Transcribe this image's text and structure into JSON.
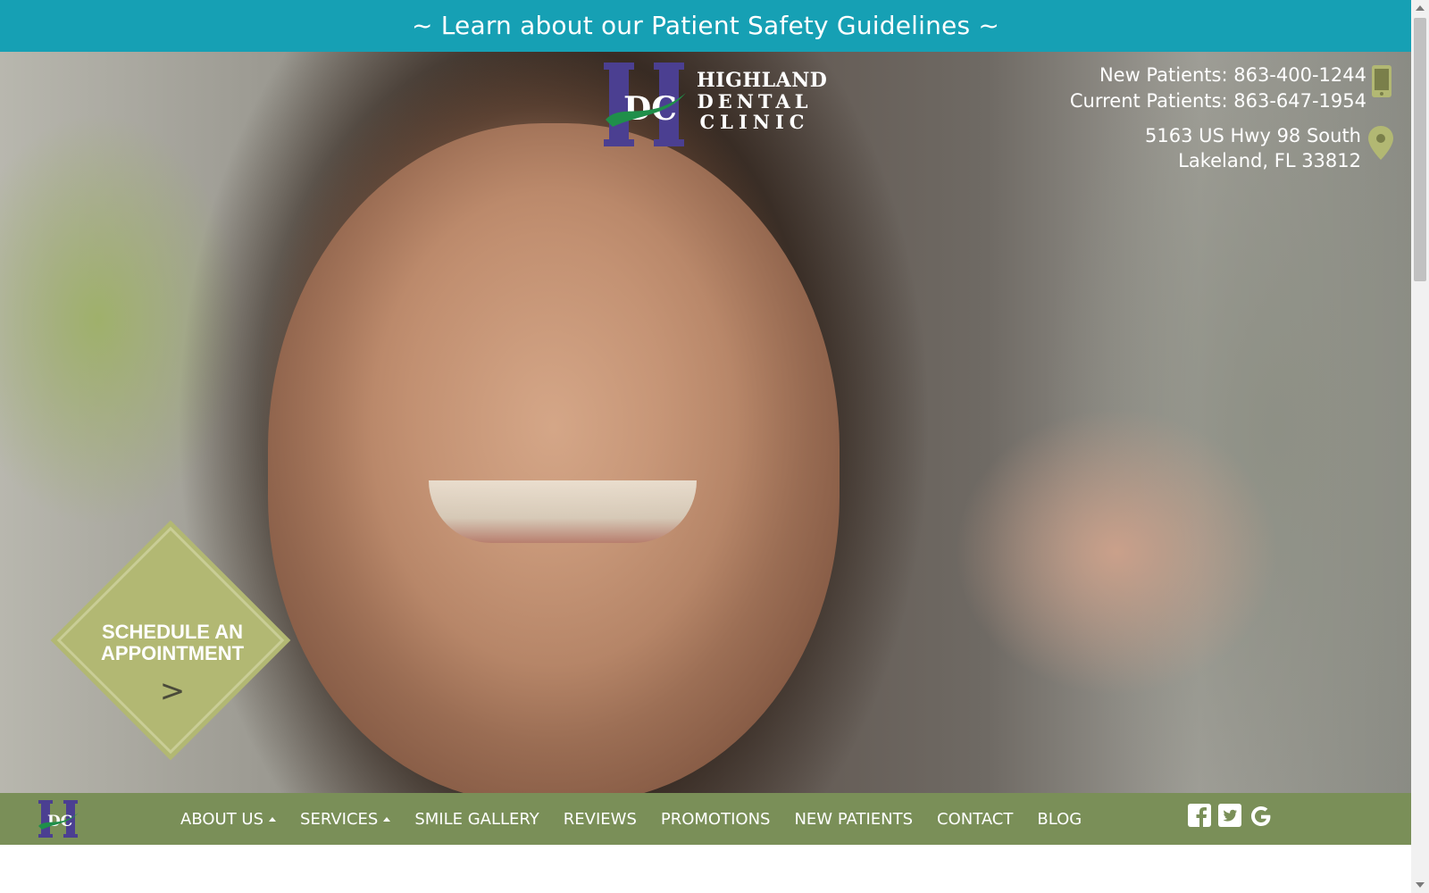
{
  "banner": {
    "text": "~ Learn about our Patient Safety Guidelines ~"
  },
  "logo": {
    "line1": "HIGHLAND",
    "line2": "DENTAL",
    "line3": "CLINIC",
    "monogram": "HDC"
  },
  "contact": {
    "new_patients": "New Patients: 863-400-1244",
    "current_patients": "Current Patients: 863-647-1954",
    "address_line1": "5163 US Hwy 98 South",
    "address_line2": "Lakeland, FL 33812"
  },
  "cta": {
    "line1": "SCHEDULE AN",
    "line2": "APPOINTMENT",
    "arrow": ">"
  },
  "nav": {
    "items": [
      {
        "label": "ABOUT US",
        "dropdown": true
      },
      {
        "label": "SERVICES",
        "dropdown": true
      },
      {
        "label": "SMILE GALLERY",
        "dropdown": false
      },
      {
        "label": "REVIEWS",
        "dropdown": false
      },
      {
        "label": "PROMOTIONS",
        "dropdown": false
      },
      {
        "label": "NEW PATIENTS",
        "dropdown": false
      },
      {
        "label": "CONTACT",
        "dropdown": false
      },
      {
        "label": "BLOG",
        "dropdown": false
      }
    ],
    "social": [
      "facebook-icon",
      "twitter-icon",
      "google-icon"
    ]
  },
  "colors": {
    "banner_bg": "#16a0b4",
    "nav_bg": "#7a8f58",
    "accent_green": "#b2b873",
    "logo_purple": "#4b3f91",
    "logo_green": "#1f8f4a"
  }
}
